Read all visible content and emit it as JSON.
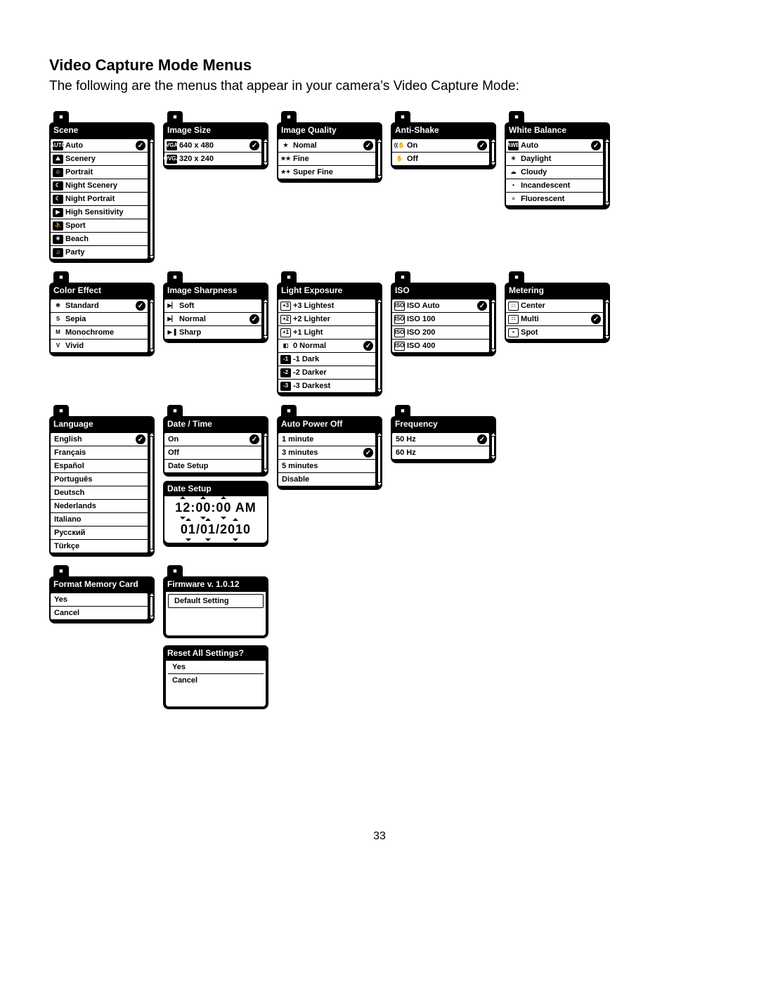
{
  "title": "Video Capture Mode Menus",
  "intro": "The following are the menus that appear in your camera’s Video Capture Mode:",
  "page_number": "33",
  "menus": {
    "scene": {
      "title": "Scene",
      "items": [
        {
          "icon": "AUTO",
          "iconStyle": "box",
          "label": "Auto",
          "selected": true
        },
        {
          "icon": "⛰",
          "iconStyle": "box",
          "label": "Scenery"
        },
        {
          "icon": "☺",
          "iconStyle": "box",
          "label": "Portrait"
        },
        {
          "icon": "☾",
          "iconStyle": "box",
          "label": "Night Scenery"
        },
        {
          "icon": "☾",
          "iconStyle": "box",
          "label": "Night Portrait"
        },
        {
          "icon": "▶",
          "iconStyle": "box",
          "label": "High Sensitivity"
        },
        {
          "icon": "⛹",
          "iconStyle": "box",
          "label": "Sport"
        },
        {
          "icon": "☀",
          "iconStyle": "box",
          "label": "Beach"
        },
        {
          "icon": "♫",
          "iconStyle": "box",
          "label": "Party"
        }
      ]
    },
    "image_size": {
      "title": "Image Size",
      "items": [
        {
          "icon": "VGA",
          "iconStyle": "box",
          "label": "640 x 480",
          "selected": true
        },
        {
          "icon": "QVGA",
          "iconStyle": "box",
          "label": "320 x 240"
        }
      ]
    },
    "image_quality": {
      "title": "Image Quality",
      "items": [
        {
          "icon": "★",
          "iconStyle": "nobox",
          "label": "Nomal",
          "selected": true
        },
        {
          "icon": "★★",
          "iconStyle": "nobox",
          "label": "Fine"
        },
        {
          "icon": "★✦",
          "iconStyle": "nobox",
          "label": "Super Fine"
        }
      ]
    },
    "anti_shake": {
      "title": "Anti-Shake",
      "items": [
        {
          "icon": "((✋",
          "iconStyle": "nobox",
          "label": "On",
          "selected": true
        },
        {
          "icon": "✋",
          "iconStyle": "nobox",
          "label": "Off"
        }
      ]
    },
    "white_balance": {
      "title": "White Balance",
      "items": [
        {
          "icon": "AWB",
          "iconStyle": "box",
          "label": "Auto",
          "selected": true
        },
        {
          "icon": "☀",
          "iconStyle": "nobox",
          "label": "Daylight"
        },
        {
          "icon": "☁",
          "iconStyle": "nobox",
          "label": "Cloudy"
        },
        {
          "icon": "•",
          "iconStyle": "nobox",
          "label": "Incandescent"
        },
        {
          "icon": "≡",
          "iconStyle": "nobox",
          "label": "Fluorescent"
        }
      ]
    },
    "color_effect": {
      "title": "Color Effect",
      "items": [
        {
          "icon": "✻",
          "iconStyle": "nobox",
          "label": "Standard",
          "selected": true
        },
        {
          "icon": "S",
          "iconStyle": "nobox",
          "label": "Sepia"
        },
        {
          "icon": "M",
          "iconStyle": "nobox",
          "label": "Monochrome"
        },
        {
          "icon": "V",
          "iconStyle": "nobox",
          "label": "Vivid"
        }
      ]
    },
    "image_sharpness": {
      "title": "Image Sharpness",
      "items": [
        {
          "icon": "▶▏",
          "iconStyle": "nobox",
          "label": "Soft"
        },
        {
          "icon": "▶▏",
          "iconStyle": "nobox",
          "label": "Normal",
          "selected": true
        },
        {
          "icon": "▶▐",
          "iconStyle": "nobox",
          "label": "Sharp"
        }
      ]
    },
    "light_exposure": {
      "title": "Light Exposure",
      "items": [
        {
          "icon": "+3",
          "iconStyle": "outline",
          "label": "+3 Lightest"
        },
        {
          "icon": "+2",
          "iconStyle": "outline",
          "label": "+2 Lighter"
        },
        {
          "icon": "+1",
          "iconStyle": "outline",
          "label": "+1 Light"
        },
        {
          "icon": "◧",
          "iconStyle": "nobox",
          "label": "0 Normal",
          "selected": true
        },
        {
          "icon": "-1",
          "iconStyle": "box",
          "label": "-1 Dark"
        },
        {
          "icon": "-2",
          "iconStyle": "box",
          "label": "-2 Darker"
        },
        {
          "icon": "-3",
          "iconStyle": "box",
          "label": "-3 Darkest"
        }
      ]
    },
    "iso": {
      "title": "ISO",
      "items": [
        {
          "icon": "ISO",
          "iconStyle": "outline",
          "label": "ISO Auto",
          "selected": true
        },
        {
          "icon": "ISO",
          "iconStyle": "outline",
          "label": "ISO 100"
        },
        {
          "icon": "ISO",
          "iconStyle": "outline",
          "label": "ISO 200"
        },
        {
          "icon": "ISO",
          "iconStyle": "outline",
          "label": "ISO 400"
        }
      ]
    },
    "metering": {
      "title": "Metering",
      "items": [
        {
          "icon": "□",
          "iconStyle": "outline",
          "label": "Center"
        },
        {
          "icon": "∷",
          "iconStyle": "outline",
          "label": "Multi",
          "selected": true
        },
        {
          "icon": "•",
          "iconStyle": "outline",
          "label": "Spot"
        }
      ]
    },
    "language": {
      "title": "Language",
      "items": [
        {
          "label": "English",
          "selected": true
        },
        {
          "label": "Français"
        },
        {
          "label": "Español"
        },
        {
          "label": "Português"
        },
        {
          "label": "Deutsch"
        },
        {
          "label": "Nederlands"
        },
        {
          "label": "Italiano"
        },
        {
          "label": "Русский"
        },
        {
          "label": "Türkçe"
        }
      ]
    },
    "date_time": {
      "title": "Date / Time",
      "items": [
        {
          "label": "On",
          "selected": true
        },
        {
          "label": "Off"
        },
        {
          "label": "Date Setup"
        }
      ]
    },
    "date_setup": {
      "title": "Date Setup",
      "time": {
        "h": "12",
        "m": "00",
        "s": "00",
        "ampm": "AM"
      },
      "date": {
        "mm": "01",
        "dd": "01",
        "yyyy": "2010"
      }
    },
    "auto_power_off": {
      "title": "Auto Power Off",
      "items": [
        {
          "label": "1 minute"
        },
        {
          "label": "3 minutes",
          "selected": true
        },
        {
          "label": "5 minutes"
        },
        {
          "label": "Disable"
        }
      ]
    },
    "frequency": {
      "title": "Frequency",
      "items": [
        {
          "label": "50 Hz",
          "selected": true
        },
        {
          "label": "60 Hz"
        }
      ]
    },
    "format_memory_card": {
      "title": "Format Memory Card",
      "items": [
        {
          "label": "Yes"
        },
        {
          "label": "Cancel"
        }
      ]
    },
    "firmware": {
      "title": "Firmware v. 1.0.12",
      "default_setting": "Default Setting"
    },
    "reset": {
      "title": "Reset All Settings?",
      "items": [
        {
          "label": "Yes"
        },
        {
          "label": "Cancel"
        }
      ]
    }
  }
}
